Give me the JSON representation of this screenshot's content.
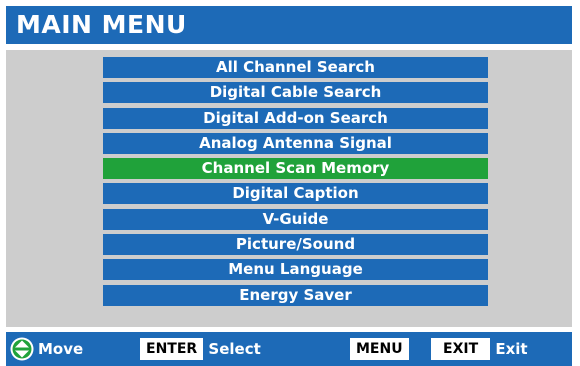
{
  "title": "MAIN MENU",
  "menu": {
    "items": [
      {
        "label": "All Channel Search",
        "selected": false
      },
      {
        "label": "Digital Cable Search",
        "selected": false
      },
      {
        "label": "Digital Add-on Search",
        "selected": false
      },
      {
        "label": "Analog Antenna Signal",
        "selected": false
      },
      {
        "label": "Channel Scan Memory",
        "selected": true
      },
      {
        "label": "Digital Caption",
        "selected": false
      },
      {
        "label": "V-Guide",
        "selected": false
      },
      {
        "label": "Picture/Sound",
        "selected": false
      },
      {
        "label": "Menu Language",
        "selected": false
      },
      {
        "label": "Energy Saver",
        "selected": false
      }
    ]
  },
  "footer": {
    "move_label": "Move",
    "enter_key": "ENTER",
    "select_label": "Select",
    "menu_key": "MENU",
    "exit_key": "EXIT",
    "exit_label": "Exit"
  },
  "colors": {
    "accent": "#1d6ab7",
    "selected": "#20a23a",
    "panel": "#cdcdcd"
  },
  "icons": {
    "move": "up-down-arrows-icon"
  }
}
